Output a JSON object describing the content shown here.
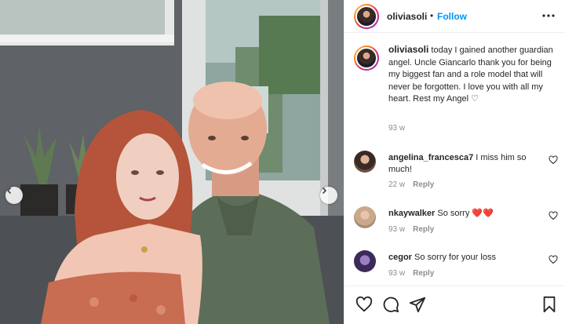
{
  "post": {
    "username": "oliviasoli",
    "follow_label": "Follow",
    "separator": "•",
    "caption": "today I gained another guardian angel. Uncle Giancarlo thank you for being my biggest fan and a role model that will never be forgotten. I love you with all my heart. Rest my Angel ♡",
    "caption_time": "93 w"
  },
  "comments": [
    {
      "username": "angelina_francesca7",
      "text": "I miss him so much!",
      "time": "22 w",
      "reply": "Reply"
    },
    {
      "username": "nkaywalker",
      "text": "So sorry ❤️❤️",
      "time": "93 w",
      "reply": "Reply"
    },
    {
      "username": "cegor",
      "text": "So sorry for your loss",
      "time": "93 w",
      "reply": "Reply"
    }
  ],
  "icons": {
    "prev": "chevron-left-icon",
    "next": "chevron-right-icon",
    "more": "more-options-icon",
    "like": "heart-icon",
    "comment": "comment-icon",
    "share": "share-icon",
    "save": "bookmark-icon"
  },
  "colors": {
    "accent": "#0095f6",
    "text": "#262626",
    "muted": "#8e8e8e",
    "heart_red": "#ed4956"
  }
}
